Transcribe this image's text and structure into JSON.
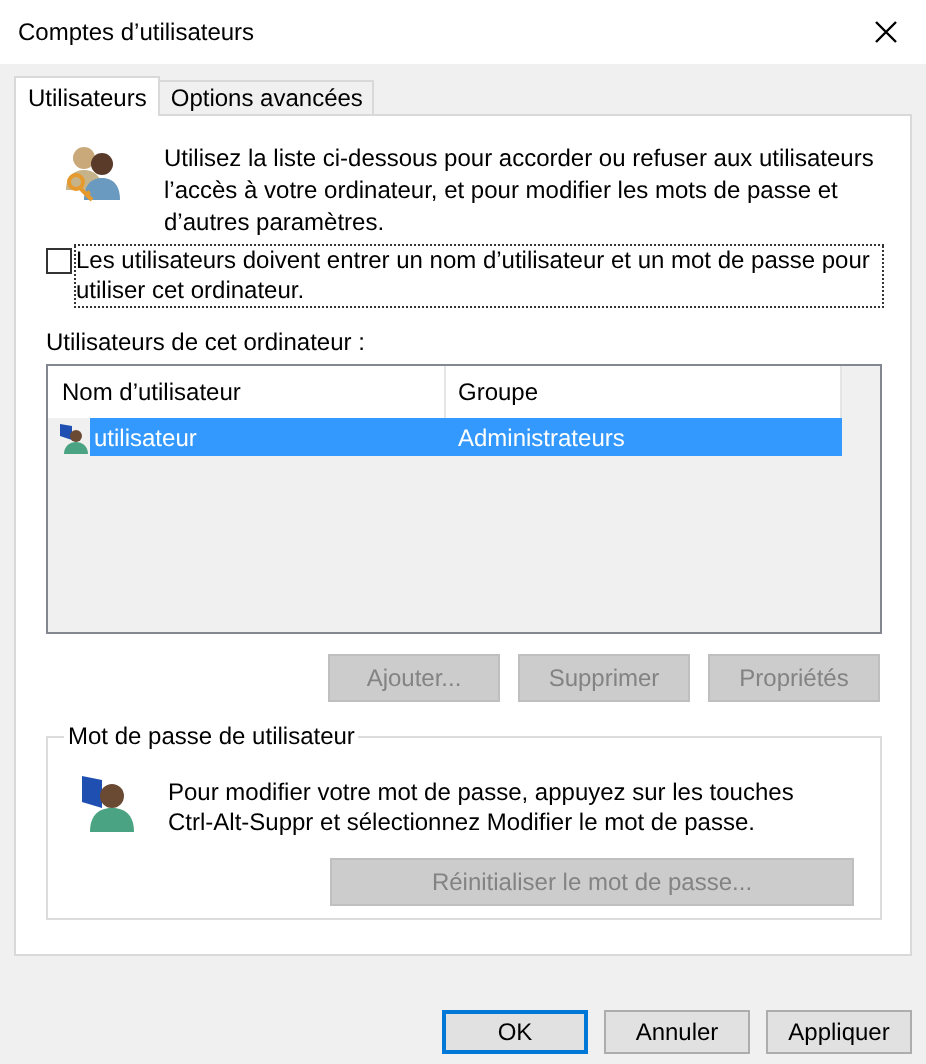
{
  "window": {
    "title": "Comptes d’utilisateurs"
  },
  "tabs": [
    {
      "label": "Utilisateurs",
      "selected": true
    },
    {
      "label": "Options avancées",
      "selected": false
    }
  ],
  "intro": "Utilisez la liste ci-dessous pour accorder ou refuser aux utilisateurs l’accès à votre ordinateur, et pour modifier les mots de passe et d’autres paramètres.",
  "login_required": {
    "label": "Les utilisateurs doivent entrer un nom d’utilisateur et un mot de passe pour utiliser cet ordinateur.",
    "checked": false
  },
  "users": {
    "label": "Utilisateurs de cet ordinateur :",
    "columns": [
      "Nom d’utilisateur",
      "Groupe"
    ],
    "rows": [
      {
        "name": "utilisateur",
        "group": "Administrateurs",
        "selected": true
      }
    ],
    "buttons": [
      {
        "label": "Ajouter...",
        "disabled": true
      },
      {
        "label": "Supprimer",
        "disabled": true
      },
      {
        "label": "Propriétés",
        "disabled": true
      }
    ]
  },
  "password": {
    "title": "Mot de passe de utilisateur",
    "text": "Pour modifier votre mot de passe, appuyez sur les touches Ctrl-Alt-Suppr et sélectionnez Modifier le mot de passe.",
    "button": {
      "label": "Réinitialiser le mot de passe...",
      "disabled": true
    }
  },
  "dialog_buttons": [
    {
      "label": "OK",
      "default": true
    },
    {
      "label": "Annuler",
      "default": false
    },
    {
      "label": "Appliquer",
      "default": false
    }
  ]
}
